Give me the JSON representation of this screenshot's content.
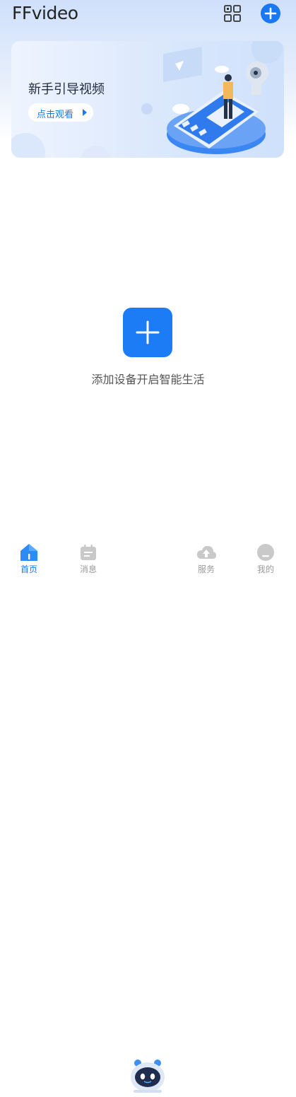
{
  "header": {
    "app_title": "FFvideo"
  },
  "banner": {
    "title": "新手引导视频",
    "watch_label": "点击观看"
  },
  "empty_state": {
    "text": "添加设备开启智能生活"
  },
  "tabbar": {
    "tabs": [
      {
        "label": "首页",
        "icon": "home-icon",
        "active": true
      },
      {
        "label": "消息",
        "icon": "message-icon",
        "active": false
      },
      {
        "label": "",
        "icon": "robot-assistant-icon",
        "active": false
      },
      {
        "label": "服务",
        "icon": "cloud-upload-icon",
        "active": false
      },
      {
        "label": "我的",
        "icon": "profile-icon",
        "active": false
      }
    ]
  },
  "colors": {
    "accent": "#1b78f5",
    "inactive": "#9a9a9a",
    "text_dark": "#222222"
  }
}
